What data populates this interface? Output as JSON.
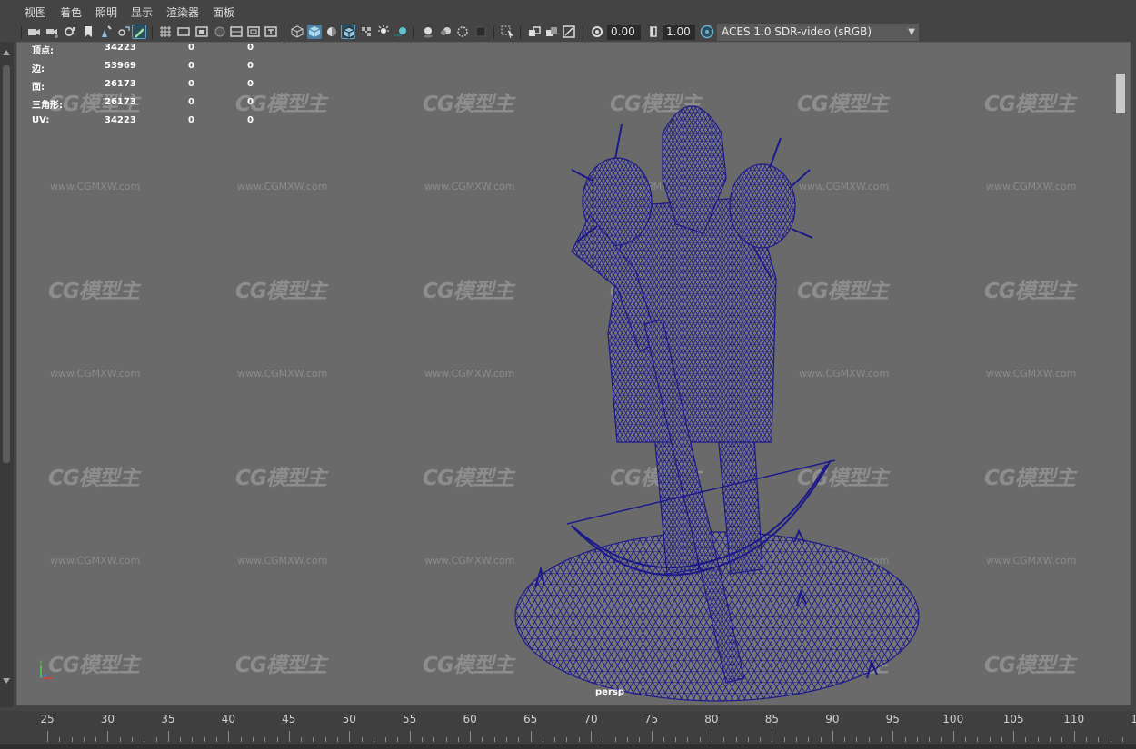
{
  "menus": [
    "视图",
    "着色",
    "照明",
    "显示",
    "渲染器",
    "面板"
  ],
  "toolbar": {
    "exposure_value": "0.00",
    "gamma_value": "1.00",
    "color_space": "ACES 1.0 SDR-video (sRGB)",
    "icons": [
      "select-camera-icon",
      "camera-attributes-icon",
      "bookmark-icon",
      "image-plane-icon",
      "grease-pencil-icon",
      "grid-icon",
      "film-gate-icon",
      "resolution-gate-icon",
      "gate-mask-icon",
      "field-chart-icon",
      "safe-action-icon",
      "safe-title-icon",
      "wireframe-icon",
      "smooth-shade-icon",
      "use-default-material-icon",
      "wireframe-on-shaded-icon",
      "textured-icon",
      "use-all-lights-icon",
      "shadows-icon",
      "screen-space-ao-icon",
      "motion-blur-icon",
      "anti-aliasing-icon",
      "depth-of-field-icon",
      "isolate-select-icon",
      "xray-icon",
      "xray-joints-icon",
      "backface-culling-icon",
      "exposure-icon",
      "gamma-icon",
      "color-management-icon"
    ]
  },
  "hud": {
    "rows": [
      {
        "label": "顶点:",
        "a": "34223",
        "b": "0",
        "c": "0"
      },
      {
        "label": "边:",
        "a": "53969",
        "b": "0",
        "c": "0"
      },
      {
        "label": "面:",
        "a": "26173",
        "b": "0",
        "c": "0"
      },
      {
        "label": "三角形:",
        "a": "26173",
        "b": "0",
        "c": "0"
      },
      {
        "label": "UV:",
        "a": "34223",
        "b": "0",
        "c": "0"
      }
    ]
  },
  "viewport": {
    "camera_label": "persp",
    "watermark_logo": "CG模型主",
    "watermark_url": "www.CGMXW.com",
    "wireframe_color": "#1c1a8a",
    "background_color": "#6a6a6a",
    "axis_labels": {
      "y": "Y",
      "x": "X",
      "z": "Z"
    }
  },
  "timeline": {
    "ticks": [
      "25",
      "30",
      "35",
      "40",
      "45",
      "50",
      "55",
      "60",
      "65",
      "70",
      "75",
      "80",
      "85",
      "90",
      "95",
      "100",
      "105",
      "110"
    ],
    "last_partial": "1"
  }
}
